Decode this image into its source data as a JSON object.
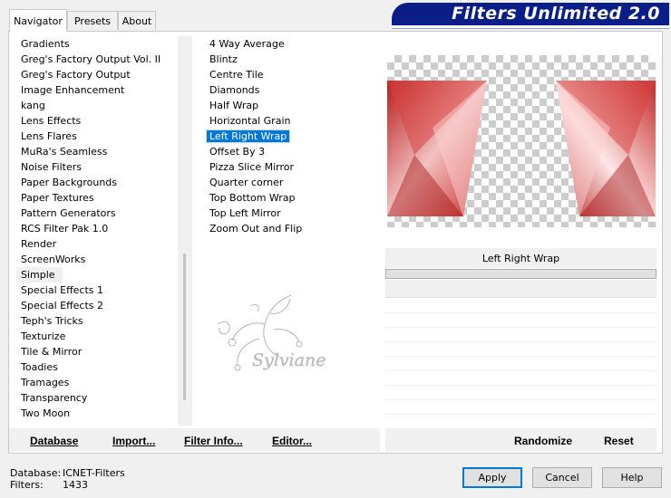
{
  "tabs": [
    {
      "label": "Navigator"
    },
    {
      "label": "Presets"
    },
    {
      "label": "About"
    }
  ],
  "banner": {
    "title": "Filters Unlimited 2.0"
  },
  "categories": [
    "Gradients",
    "Greg's Factory Output Vol. II",
    "Greg's Factory Output",
    "Image Enhancement",
    "kang",
    "Lens Effects",
    "Lens Flares",
    "MuRa's Seamless",
    "Noise Filters",
    "Paper Backgrounds",
    "Paper Textures",
    "Pattern Generators",
    "RCS Filter Pak 1.0",
    "Render",
    "ScreenWorks",
    "Simple",
    "Special Effects 1",
    "Special Effects 2",
    "Teph's Tricks",
    "Texturize",
    "Tile & Mirror",
    "Toadies",
    "Tramages",
    "Transparency",
    "Two Moon"
  ],
  "selected_category": "Simple",
  "filters": [
    "4 Way Average",
    "Blintz",
    "Centre Tile",
    "Diamonds",
    "Half Wrap",
    "Horizontal Grain",
    "Left Right Wrap",
    "Offset By 3",
    "Pizza Slice Mirror",
    "Quarter corner",
    "Top Bottom Wrap",
    "Top Left Mirror",
    "Zoom Out and Flip"
  ],
  "selected_filter": "Left Right Wrap",
  "preview": {
    "filter_name": "Left Right Wrap"
  },
  "watermark_text": "Sylviane",
  "toolbar": {
    "database": "Database",
    "import": "Import...",
    "filter_info": "Filter Info...",
    "editor": "Editor...",
    "randomize": "Randomize",
    "reset": "Reset"
  },
  "status": {
    "database_label": "Database:",
    "database_value": "ICNET-Filters",
    "filters_label": "Filters:",
    "filters_value": "1433"
  },
  "buttons": {
    "apply": "Apply",
    "cancel": "Cancel",
    "help": "Help"
  },
  "colors": {
    "banner": "#0b1e88",
    "selection": "#0078d7",
    "accent_red": "#c62828"
  }
}
